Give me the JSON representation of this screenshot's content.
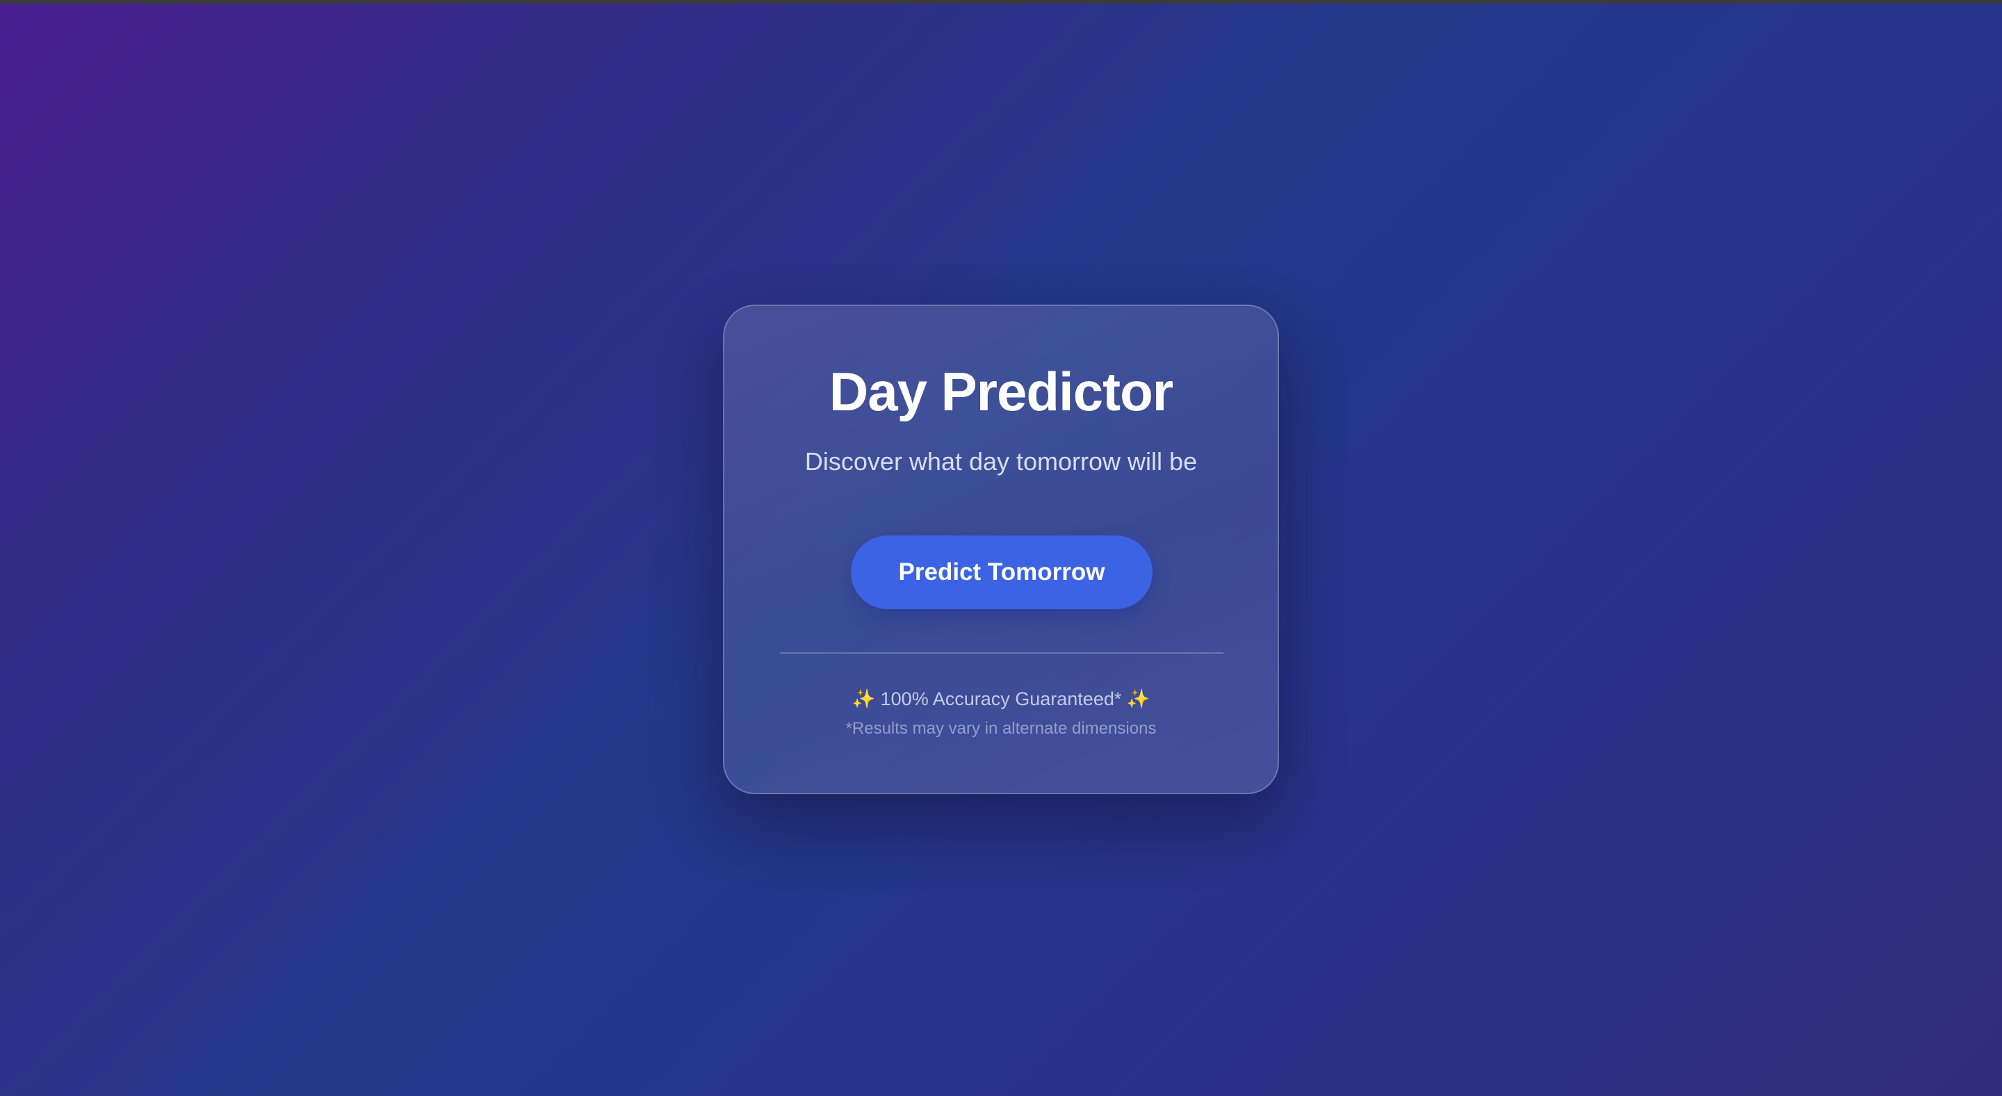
{
  "app": {
    "title": "Day Predictor",
    "subtitle": "Discover what day tomorrow will be"
  },
  "actions": {
    "predict_label": "Predict Tomorrow"
  },
  "footer": {
    "sparkle_left": "✨",
    "accuracy_text": "100% Accuracy Guaranteed*",
    "sparkle_right": "✨",
    "disclaimer": "*Results may vary in alternate dimensions"
  },
  "colors": {
    "background_start": "#4a1e91",
    "background_mid": "#24388a",
    "button": "#3b63e3",
    "text_primary": "#ffffff"
  },
  "icons": {
    "sparkle": "sparkles-icon"
  }
}
